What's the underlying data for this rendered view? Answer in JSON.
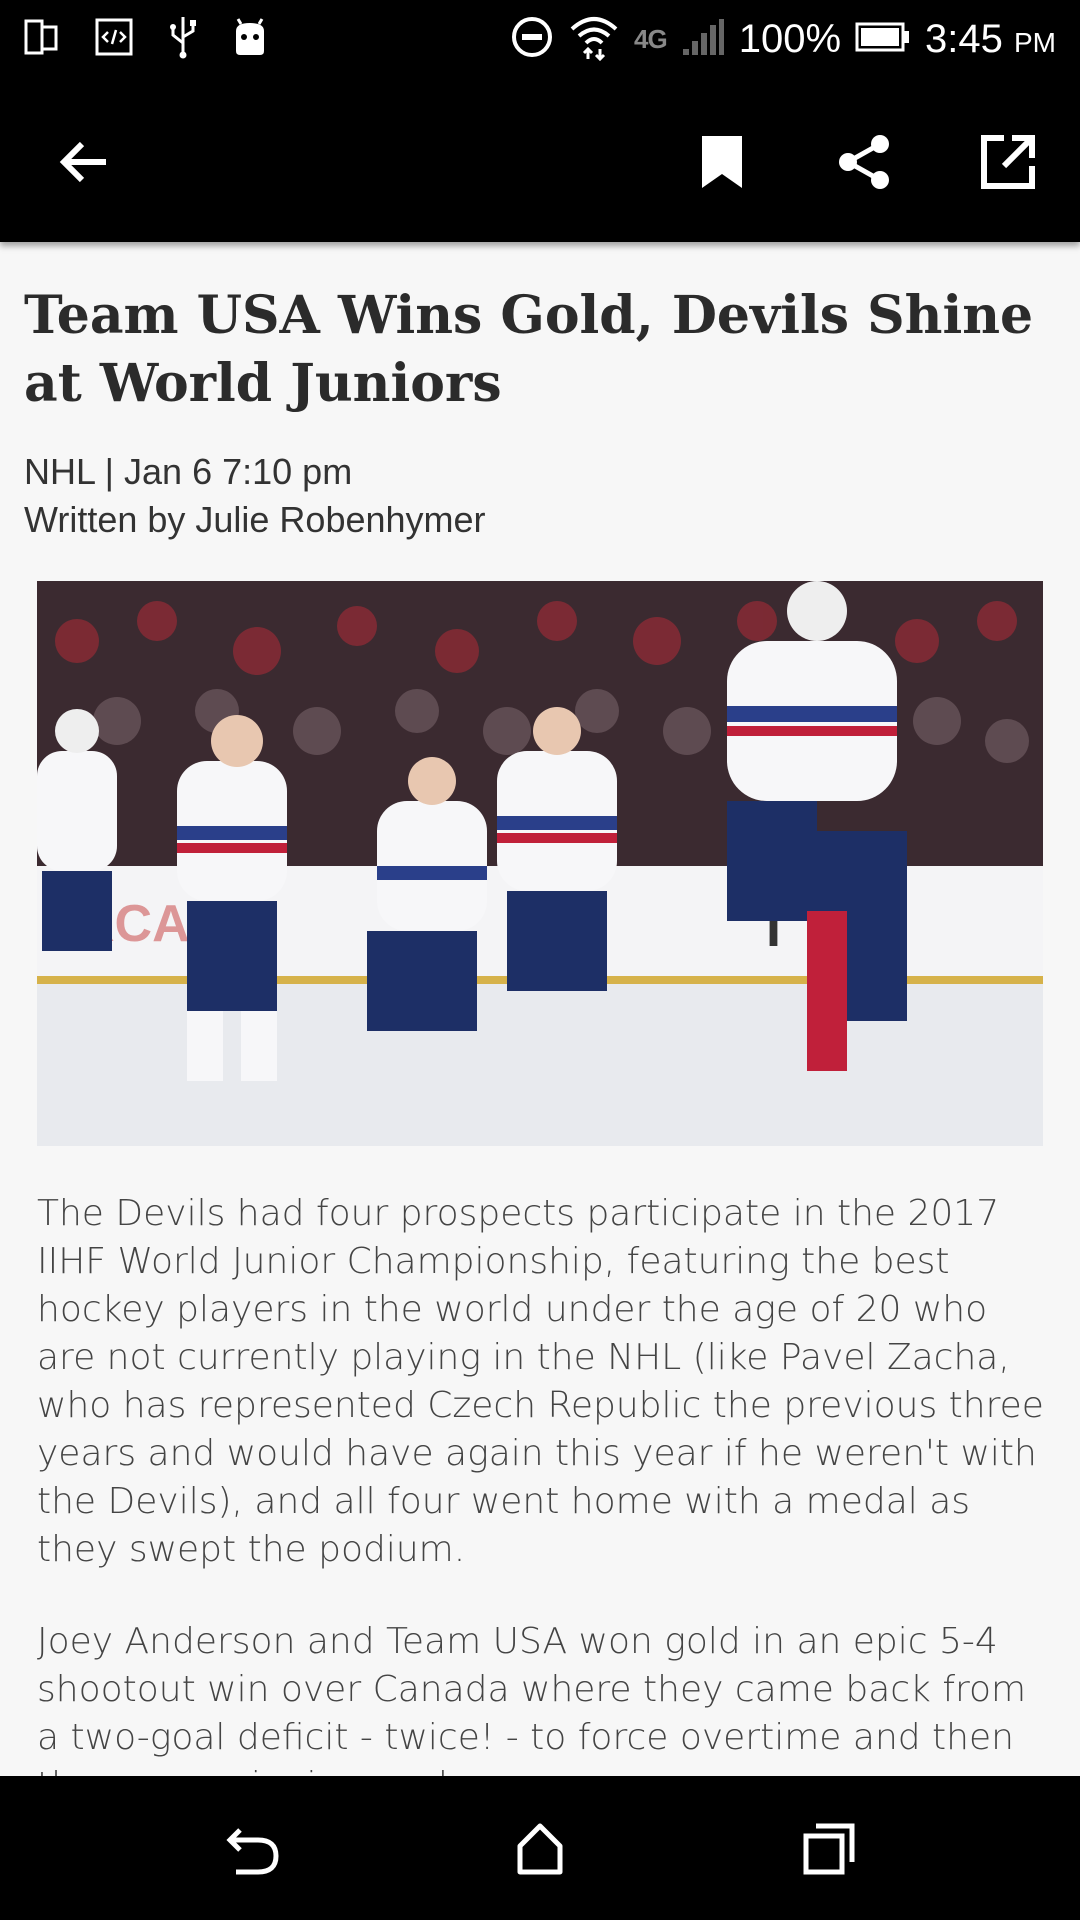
{
  "status_bar": {
    "network_label": "4G",
    "battery": "100%",
    "time": "3:45",
    "time_suffix": "PM",
    "icons": [
      "screen-icon",
      "code-icon",
      "usb-icon",
      "android-icon",
      "dnd-icon",
      "wifi-icon",
      "signal-icon",
      "battery-icon"
    ]
  },
  "app_bar": {
    "icons": [
      "back-arrow-icon",
      "bookmark-icon",
      "share-icon",
      "open-external-icon"
    ]
  },
  "article": {
    "title": "Team USA Wins Gold, Devils Shine at World Juniors",
    "meta_line": "NHL | Jan 6 7:10 pm",
    "author_line": "Written by Julie Robenhymer",
    "paragraphs": [
      "The Devils had four prospects participate in the 2017 IIHF World Junior Championship, featuring the best hockey players in the world under the age of 20 who are not currently playing in the NHL (like Pavel Zacha, who has represented Czech Republic the previous three years and would have again this year if he weren't with the Devils), and all four went home with a medal as they swept the podium.",
      "Joey Anderson and Team USA won gold in an epic 5-4 shootout win over Canada where they came back from a two-goal deficit - twice! - to force overtime and then the game-winning goal."
    ]
  },
  "nav_bar": {
    "icons": [
      "back-icon",
      "home-icon",
      "recent-apps-icon"
    ]
  }
}
